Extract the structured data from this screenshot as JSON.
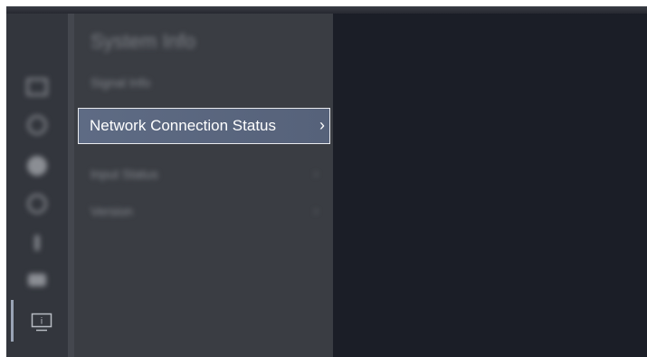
{
  "panel": {
    "title": "System Info"
  },
  "menu": {
    "items": [
      {
        "label": "Signal Info",
        "chevron": ""
      },
      {
        "label": "Network Connection Status",
        "chevron": "›",
        "selected": true
      },
      {
        "label": "Input Status",
        "chevron": "›"
      },
      {
        "label": "Version",
        "chevron": "›"
      }
    ]
  },
  "rail": {
    "icons": [
      {
        "name": "picture-icon"
      },
      {
        "name": "sound-icon"
      },
      {
        "name": "network-icon"
      },
      {
        "name": "display-icon"
      },
      {
        "name": "remote-icon"
      },
      {
        "name": "camera-icon"
      },
      {
        "name": "info-icon",
        "active": true
      }
    ],
    "info_glyph": "i"
  },
  "colors": {
    "background": "#1b1e27",
    "rail": "#33363d",
    "panel": "#3a3d43",
    "selection": "#5e6b84",
    "selection_border": "#e9ebef"
  }
}
